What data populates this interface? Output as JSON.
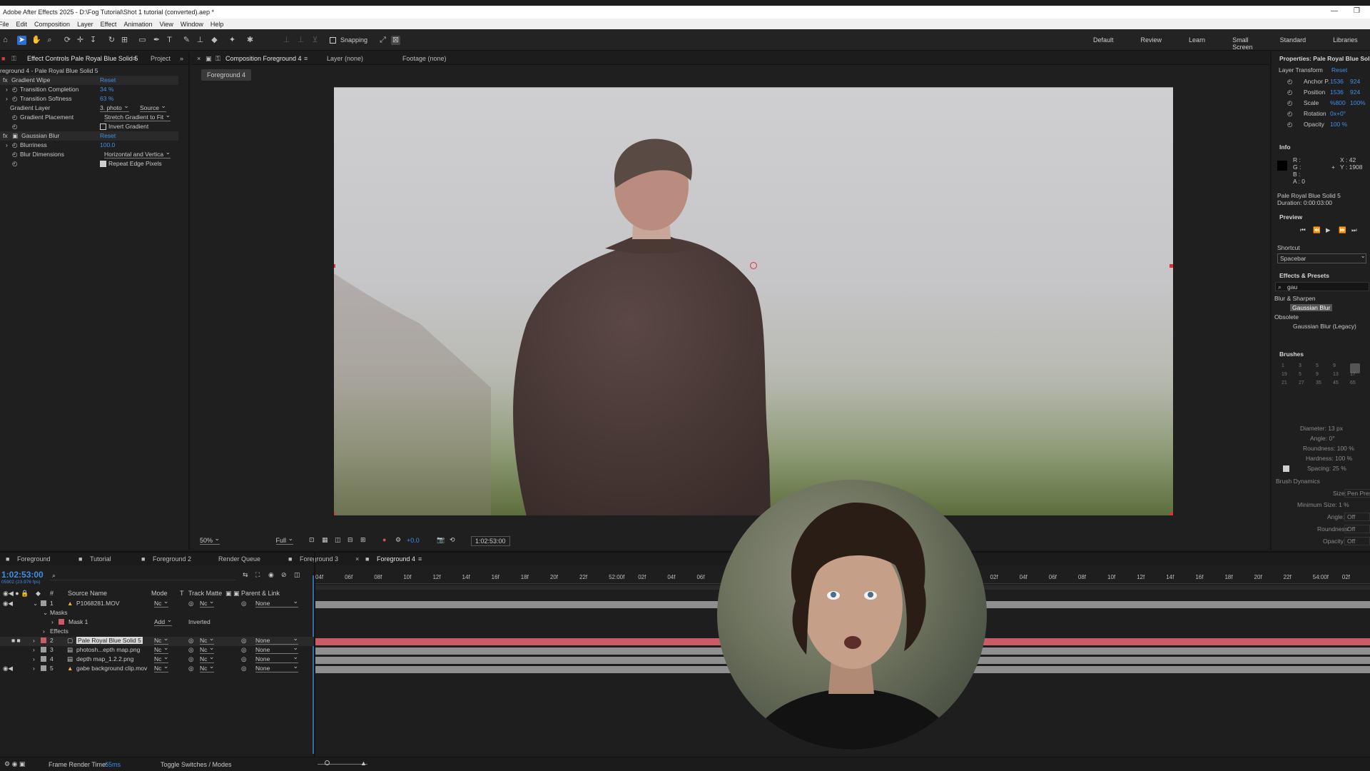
{
  "window": {
    "title": "Adobe After Effects 2025 - D:\\Fog Tutorial\\Shot 1 tutorial (converted).aep *",
    "minimize": "—",
    "restore": "❐"
  },
  "menu": [
    "File",
    "Edit",
    "Composition",
    "Layer",
    "Effect",
    "Animation",
    "View",
    "Window",
    "Help"
  ],
  "toolbar": {
    "snapping_label": "Snapping",
    "workspaces": [
      "Default",
      "Review",
      "Learn",
      "Small Screen",
      "Standard",
      "Libraries"
    ]
  },
  "effect_controls": {
    "tab_label": "Effect Controls Pale Royal Blue Solid 5",
    "project_tab": "Project",
    "breadcrumb": "reground 4 - Pale Royal Blue Solid 5",
    "effects": [
      {
        "name": "Gradient Wipe",
        "reset": "Reset"
      },
      {
        "name": "Gaussian Blur",
        "reset": "Reset"
      }
    ],
    "props": {
      "transition_completion": {
        "label": "Transition Completion",
        "value": "34 %"
      },
      "transition_softness": {
        "label": "Transition Softness",
        "value": "63 %"
      },
      "gradient_layer": {
        "label": "Gradient Layer",
        "value": "3. photo",
        "source": "Source"
      },
      "gradient_placement": {
        "label": "Gradient Placement",
        "value": "Stretch Gradient to Fit"
      },
      "invert_gradient": {
        "label": "Invert Gradient"
      },
      "blurriness": {
        "label": "Blurriness",
        "value": "100.0"
      },
      "blur_dimensions": {
        "label": "Blur Dimensions",
        "value": "Horizontal and Vertica"
      },
      "repeat_edge": {
        "label": "Repeat Edge Pixels"
      }
    }
  },
  "composition": {
    "tab_label": "Composition Foreground 4",
    "layer_tab": "Layer (none)",
    "footage_tab": "Footage (none)",
    "comp_chip": "Foreground 4",
    "zoom": "50%",
    "resolution": "Full",
    "exposure": "+0.0",
    "timecode": "1:02:53:00"
  },
  "properties": {
    "title": "Properties: Pale Royal Blue Solid 5",
    "layer_transform": "Layer Transform",
    "reset": "Reset",
    "rows": [
      {
        "label": "Anchor P.",
        "v1": "1536",
        "v2": "924"
      },
      {
        "label": "Position",
        "v1": "1536",
        "v2": "924"
      },
      {
        "label": "Scale",
        "v1": "%800",
        "v2": "100%"
      },
      {
        "label": "Rotation",
        "v1": "0x+0°",
        "v2": ""
      },
      {
        "label": "Opacity",
        "v1": "100 %",
        "v2": ""
      }
    ]
  },
  "info": {
    "title": "Info",
    "r": "R :",
    "g": "G :",
    "b": "B :",
    "a": "A : 0",
    "x": "X : 42",
    "y": "Y : 1908",
    "layer_name": "Pale Royal Blue Solid 5",
    "duration": "Duration: 0:00:03:00"
  },
  "preview": {
    "title": "Preview",
    "shortcut_label": "Shortcut",
    "shortcut_value": "Spacebar"
  },
  "effects_presets": {
    "title": "Effects & Presets",
    "search": "gau",
    "group1": "Blur & Sharpen",
    "item1": "Gaussian Blur",
    "group2": "Obsolete",
    "item2": "Gaussian Blur (Legacy)"
  },
  "brushes": {
    "title": "Brushes",
    "sizes": [
      "1",
      "3",
      "5",
      "9",
      "",
      "",
      "",
      "",
      "",
      "19",
      "5",
      "9",
      "13",
      "17",
      "21",
      "27",
      "35",
      "45",
      "65"
    ],
    "diameter": "Diameter: 13 px",
    "angle": "Angle: 0°",
    "roundness": "Roundness: 100 %",
    "hardness": "Hardness: 100 %",
    "spacing": "Spacing: 25 %",
    "dynamics": "Brush Dynamics",
    "size_label": "Size:",
    "size_value": "Pen Pressure",
    "min_size": "Minimum Size: 1 %",
    "angle2": "Angle:",
    "roundness2": "Roundness:",
    "opacity": "Opacity:",
    "off": "Off"
  },
  "timeline": {
    "tabs": [
      "Foreground",
      "Tutorial",
      "Foreground 2",
      "Render Queue",
      "Foreground 3",
      "Foreground 4"
    ],
    "current_time": "1:02:53:00",
    "frame_info": "05902 (23.976 fps)",
    "columns": {
      "num": "#",
      "source": "Source Name",
      "mode": "Mode",
      "t": "T",
      "track_matte": "Track Matte",
      "parent": "Parent & Link"
    },
    "ruler": [
      "04f",
      "06f",
      "08f",
      "10f",
      "12f",
      "14f",
      "16f",
      "18f",
      "20f",
      "22f",
      "52:00f",
      "02f",
      "04f",
      "06f",
      "08f",
      "10f",
      "12f",
      "14f",
      "16f",
      "18f",
      "20f",
      "22f",
      "54:00f",
      "02f",
      "04f",
      "06f",
      "08f",
      "10f",
      "12f",
      "14f",
      "16f",
      "18f",
      "20f",
      "22f",
      "54:00f",
      "02f"
    ],
    "layers": [
      {
        "num": "1",
        "name": "P1068281.MOV",
        "mode": "Nc",
        "matte": "Nc",
        "parent": "None",
        "color": "#9e9e9e"
      },
      {
        "num": "2",
        "name": "Pale Royal Blue Solid 5",
        "mode": "Nc",
        "matte": "Nc",
        "parent": "None",
        "color": "#c95c67"
      },
      {
        "num": "3",
        "name": "photosh...epth map.png",
        "mode": "Nc",
        "matte": "Nc",
        "parent": "None",
        "color": "#9e9e9e"
      },
      {
        "num": "4",
        "name": "depth map_1.2.2.png",
        "mode": "Nc",
        "matte": "Nc",
        "parent": "None",
        "color": "#9e9e9e"
      },
      {
        "num": "5",
        "name": "gabe background clip.mov",
        "mode": "Nc",
        "matte": "Nc",
        "parent": "None",
        "color": "#9e9e9e"
      }
    ],
    "masks": "Masks",
    "mask1": "Mask 1",
    "mask_mode": "Add",
    "inverted": "Inverted",
    "effects": "Effects"
  },
  "status": {
    "frame_render": "Frame Render Time:",
    "frame_render_value": "65ms",
    "toggle": "Toggle Switches / Modes"
  },
  "colors": {
    "accent": "#2f6ecf",
    "value_blue": "#3f8fe8",
    "red_track": "#c95c67",
    "gray_track": "#8f8f8f"
  }
}
